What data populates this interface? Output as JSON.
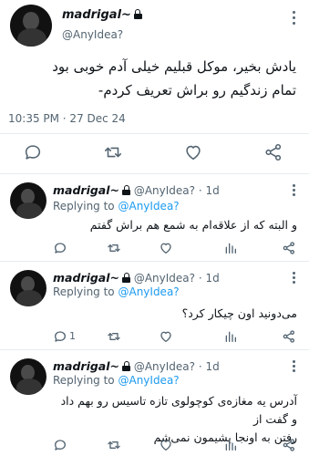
{
  "main_tweet": {
    "display_name": "madrigal~",
    "handle": "@AnyIdea?",
    "text_lines": [
      "یادش بخیر، موکل قبلیم خیلی آدم خوبی بود",
      "تمام زندگیم رو براش تعریف کردم-"
    ],
    "timestamp": "10:35 PM · 27 Dec 24"
  },
  "replies": [
    {
      "display_name": "madrigal~",
      "handle": "@AnyIdea?",
      "age": "· 1d",
      "replying_prefix": "Replying to",
      "replying_to": "@AnyIdea?",
      "text_lines": [
        "و البته که از علاقه‌ام به شمع هم براش گفتم"
      ],
      "reply_count": "",
      "retweet_count": ""
    },
    {
      "display_name": "madrigal~",
      "handle": "@AnyIdea?",
      "age": "· 1d",
      "replying_prefix": "Replying to",
      "replying_to": "@AnyIdea?",
      "text_lines": [
        "می‌دونید اون چیکار کرد؟"
      ],
      "reply_count": "1",
      "retweet_count": ""
    },
    {
      "display_name": "madrigal~",
      "handle": "@AnyIdea?",
      "age": "· 1d",
      "replying_prefix": "Replying to",
      "replying_to": "@AnyIdea?",
      "text_lines": [
        "آدرس یه مغازه‌ی کوچولوی تازه تاسیس رو بهم داد و گفت از",
        "رفتن به اونجا پشیمون نمی‌شم"
      ],
      "reply_count": "",
      "retweet_count": ""
    }
  ],
  "icons": {
    "more": "more-vertical-icon",
    "reply": "reply-bubble-icon",
    "retweet": "retweet-icon",
    "like": "heart-icon",
    "views": "views-bar-chart-icon",
    "share": "share-icon",
    "lock": "lock-icon"
  },
  "colors": {
    "text": "#0f1419",
    "secondary": "#536471",
    "link": "#1d9bf0",
    "divider": "#e6ecf0"
  }
}
